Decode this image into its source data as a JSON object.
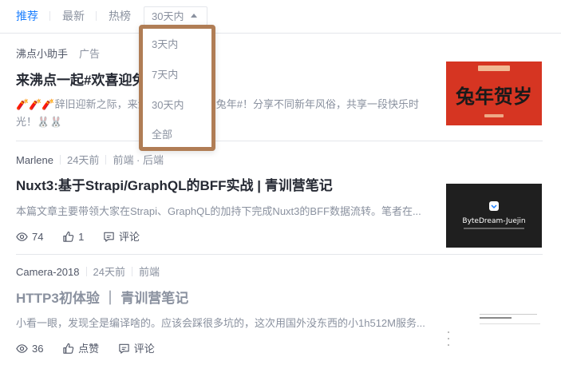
{
  "tabs": {
    "recommended": "推荐",
    "latest": "最新",
    "hot": "热榜",
    "period_selected": "30天内"
  },
  "period_dropdown": {
    "options": [
      "3天内",
      "7天内",
      "30天内",
      "全部"
    ]
  },
  "articles": [
    {
      "author": "沸点小助手",
      "tag": "广告",
      "title": "来沸点一起#欢喜迎兔年#",
      "abstract_emoji": "🧨🧨🧨",
      "abstract": "辞旧迎新之际，来沸点一起#欢喜迎兔年#！分享不同新年风俗，共享一段快乐时光！",
      "abstract_tail": "🐰🐰",
      "thumb_text": "兔年贺岁"
    },
    {
      "author": "Marlene",
      "time": "24天前",
      "tags": "前端 · 后端",
      "title": "Nuxt3:基于Strapi/GraphQL的BFF实战 | 青训营笔记",
      "abstract": "本篇文章主要带领大家在Strapi、GraphQL的加持下完成Nuxt3的BFF数据流转。笔者在...",
      "views": "74",
      "likes": "1",
      "comments": "评论",
      "thumb_text": "ByteDream-Juejin"
    },
    {
      "author": "Camera-2018",
      "time": "24天前",
      "tags": "前端",
      "title": "HTTP3初体验 ｜ 青训营笔记",
      "abstract": "小看一眼，发现全是编译啥的。应该会踩很多坑的，这次用国外没东西的小1h512M服务...",
      "views": "36",
      "likes": "点赞",
      "comments": "评论"
    }
  ],
  "colors": {
    "accent": "#1e80ff",
    "dropdown_border": "#b07d55",
    "ad_thumb_bg": "#d63522",
    "dark_thumb_bg": "#1f1f1f"
  }
}
